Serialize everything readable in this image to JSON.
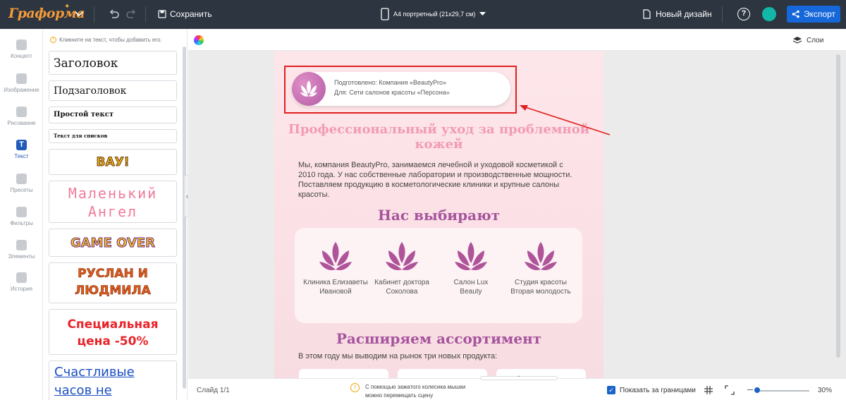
{
  "app": {
    "logo": "Граформа",
    "save_label": "Сохранить",
    "format": "A4 портретный (21x29,7 см)",
    "new_design_label": "Новый дизайн",
    "help": "?",
    "export_label": "Экспорт",
    "avatar_color": "#12b7a8",
    "accent": "#1667d9"
  },
  "rail": {
    "items": [
      "Концепт",
      "Изображение",
      "Рисование",
      "Текст",
      "Пресеты",
      "Фильтры",
      "Элементы",
      "История"
    ],
    "active": "Текст"
  },
  "panel": {
    "hint": "Кликните на текст, чтобы добавить его.",
    "fonts": [
      "Заголовок",
      "Подзаголовок",
      "Простой текст",
      "Текст для списков",
      "ВАУ!",
      "Маленький Ангел",
      "GAME OVER",
      "Руслан и Людмила",
      "Специальная цена -50%",
      "Счастливые часов не наблюдают"
    ]
  },
  "workspace": {
    "layers_label": "Слои"
  },
  "slide": {
    "badge_line1": "Подготовлено: Компания «BeautyPro»",
    "badge_line2": "Для: Сети салонов красоты «Персона»",
    "title": "Профессиональный уход за проблемной кожей",
    "paragraph": "Мы, компания BeautyPro, занимаемся лечебной и уходовой косметикой с 2010 года. У нас собственные лаборатории и производственные мощности. Поставляем продукцию в косметологические клиники и крупные салоны красоты.",
    "choose_title": "Нас выбирают",
    "clients": [
      "Клиника Елизаветы Ивановой",
      "Кабинет доктора Соколова",
      "Салон Lux Beauty",
      "Студия красоты Вторая молодость"
    ],
    "range_title": "Расширяем ассортимент",
    "range_text": "В этом году мы выводим на рынок три новых продукта:"
  },
  "status": {
    "slide": "Слайд 1/1",
    "hint": "С помощью зажатого колесика мышки можно перемещать сцену",
    "show_bounds": "Показать за границами",
    "zoom": "30%",
    "zoom_fraction": 0.3
  }
}
